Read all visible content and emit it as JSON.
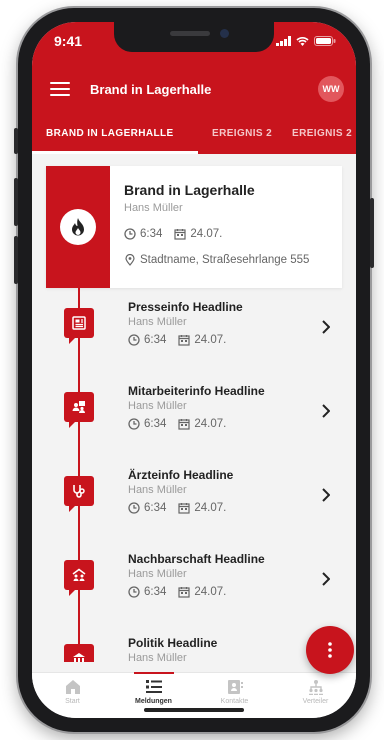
{
  "status_bar": {
    "time": "9:41"
  },
  "app_bar": {
    "title": "Brand in Lagerhalle",
    "avatar_initials": "WW"
  },
  "tabs": [
    {
      "label": "BRAND IN LAGERHALLE",
      "active": true
    },
    {
      "label": "EREIGNIS 2",
      "active": false
    },
    {
      "label": "EREIGNIS 2",
      "active": false
    }
  ],
  "main_event": {
    "title": "Brand in Lagerhalle",
    "author": "Hans Müller",
    "time": "6:34",
    "date": "24.07.",
    "location": "Stadtname, Straßesehrlange 555",
    "icon": "flame-icon"
  },
  "messages": [
    {
      "title": "Presseinfo Headline",
      "author": "Hans Müller",
      "time": "6:34",
      "date": "24.07.",
      "icon": "newspaper-icon"
    },
    {
      "title": "Mitarbeiterinfo Headline",
      "author": "Hans Müller",
      "time": "6:34",
      "date": "24.07.",
      "icon": "team-presentation-icon"
    },
    {
      "title": "Ärzteinfo Headline",
      "author": "Hans Müller",
      "time": "6:34",
      "date": "24.07.",
      "icon": "stethoscope-icon"
    },
    {
      "title": "Nachbarschaft Headline",
      "author": "Hans Müller",
      "time": "6:34",
      "date": "24.07.",
      "icon": "neighborhood-icon"
    },
    {
      "title": "Politik Headline",
      "author": "Hans Müller",
      "time": "",
      "date": "",
      "icon": "government-building-icon"
    }
  ],
  "bottom_nav": [
    {
      "label": "Start",
      "icon": "home-icon",
      "active": false
    },
    {
      "label": "Meldungen",
      "icon": "list-icon",
      "active": true
    },
    {
      "label": "Kontakte",
      "icon": "contacts-icon",
      "active": false
    },
    {
      "label": "Verteiler",
      "icon": "distribution-icon",
      "active": false
    }
  ],
  "colors": {
    "brand_red": "#c8141d",
    "background": "#f3f3f3",
    "muted_text": "#9a9a9a"
  }
}
